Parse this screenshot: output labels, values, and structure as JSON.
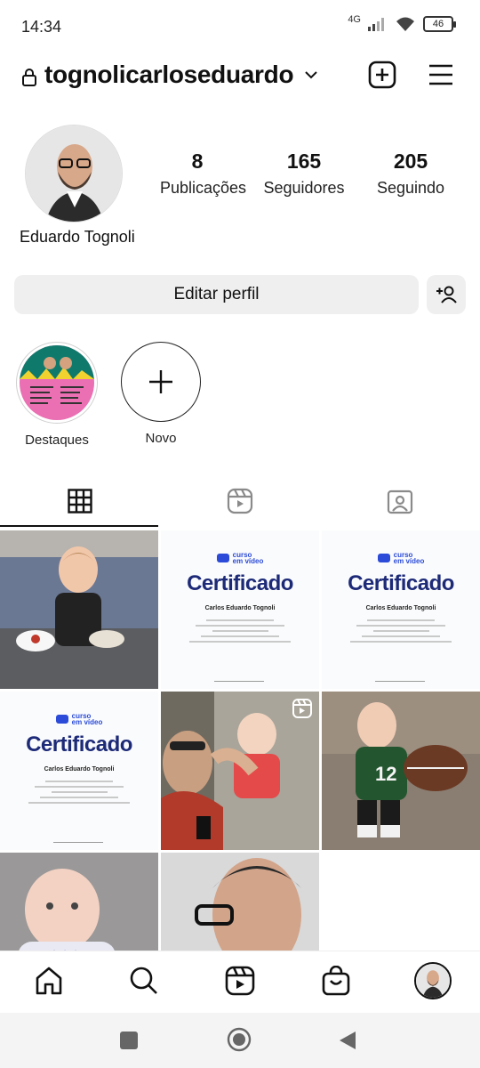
{
  "status": {
    "time": "14:34",
    "network": "4G",
    "battery": "46"
  },
  "header": {
    "username": "tognolicarloseduardo"
  },
  "profile": {
    "display_name": "Eduardo Tognoli",
    "stats": [
      {
        "value": "8",
        "label": "Publicações"
      },
      {
        "value": "165",
        "label": "Seguidores"
      },
      {
        "value": "205",
        "label": "Seguindo"
      }
    ],
    "edit_label": "Editar perfil"
  },
  "highlights": [
    {
      "label": "Destaques"
    },
    {
      "label": "Novo"
    }
  ],
  "tabs": [
    {
      "name": "grid-icon"
    },
    {
      "name": "reels-icon"
    },
    {
      "name": "tagged-icon"
    }
  ],
  "certificate": {
    "logo_line1": "curso",
    "logo_line2": "em vídeo",
    "title": "Certificado",
    "name": "Carlos Eduardo Tognoli"
  },
  "colors": {
    "accent": "#111111",
    "button_bg": "#efefef",
    "cert_blue": "#1d2a78"
  }
}
